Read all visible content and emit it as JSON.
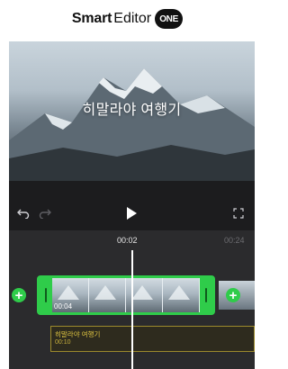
{
  "brand": {
    "name_bold": "Smart",
    "name_regular": "Editor",
    "badge": "ONE"
  },
  "preview": {
    "title": "히말라야 여행기"
  },
  "controls": {
    "undo": "undo-icon",
    "redo": "redo-icon",
    "play": "play-icon",
    "fullscreen": "fullscreen-icon"
  },
  "timeline": {
    "current_time": "00:02",
    "end_time": "00:24",
    "video_clip": {
      "duration": "00:04"
    },
    "text_clip": {
      "label": "히말라야 여행기",
      "duration": "00:10"
    }
  },
  "colors": {
    "accent": "#2fcc4a",
    "text_track": "#e3c842"
  }
}
